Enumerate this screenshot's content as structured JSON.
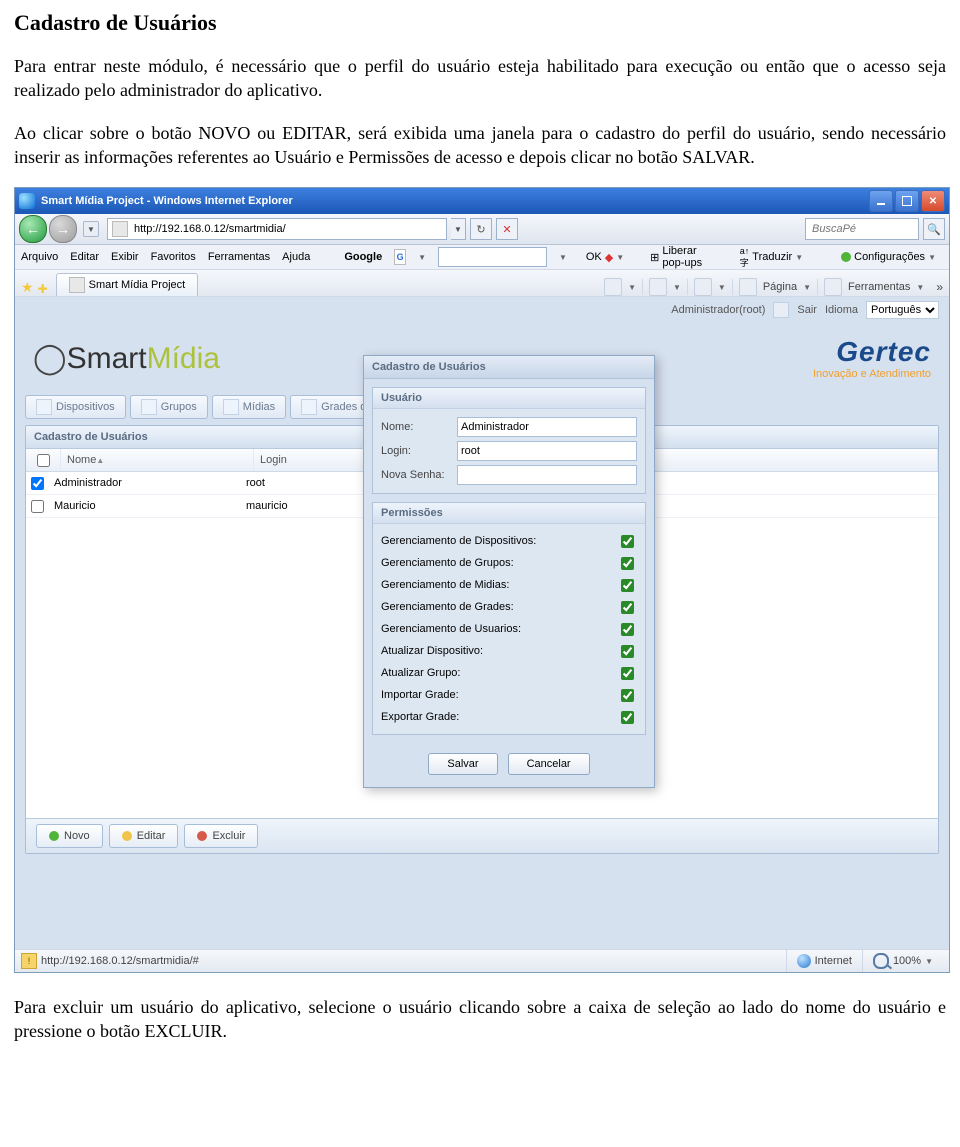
{
  "doc": {
    "heading": "Cadastro de Usuários",
    "p1": "Para entrar neste módulo, é necessário que o perfil do usuário esteja habilitado para execução ou então que o acesso seja realizado pelo administrador do aplicativo.",
    "p2": "Ao clicar sobre o botão NOVO ou EDITAR, será exibida uma janela para o cadastro do perfil do usuário, sendo necessário inserir as informações referentes ao Usuário e Permissões de acesso e depois clicar no botão SALVAR.",
    "p3": "Para excluir um usuário do aplicativo, selecione o usuário clicando sobre a caixa de seleção ao lado do nome do usuário e pressione o botão EXCLUIR."
  },
  "window": {
    "title": "Smart Mídia Project - Windows Internet Explorer"
  },
  "nav": {
    "url": "http://192.168.0.12/smartmidia/",
    "search_placeholder": "BuscaPé"
  },
  "menu": {
    "items": [
      "Arquivo",
      "Editar",
      "Exibir",
      "Favoritos",
      "Ferramentas",
      "Ajuda"
    ],
    "google_label": "Google",
    "g_btn": "G",
    "ok_label": "OK",
    "popup_label": "Liberar pop-ups",
    "translate_label": "Traduzir",
    "config_label": "Configurações"
  },
  "tab": {
    "title": "Smart Mídia Project",
    "pagina": "Página",
    "ferr": "Ferramentas"
  },
  "apptop": {
    "admin": "Administrador(root)",
    "sair": "Sair",
    "idioma_lbl": "Idioma",
    "idioma_val": "Português"
  },
  "logo": {
    "smart_a": "Smart",
    "smart_b": "Mídia",
    "gertec": "Gertec",
    "gertec_sub": "Inovação e Atendimento"
  },
  "navtabs": [
    "Dispositivos",
    "Grupos",
    "Mídias",
    "Grades de Program"
  ],
  "panel": {
    "title": "Cadastro de Usuários",
    "cols": [
      "Nome",
      "Login"
    ],
    "rows": [
      {
        "checked": true,
        "nome": "Administrador",
        "login": "root"
      },
      {
        "checked": false,
        "nome": "Mauricio",
        "login": "mauricio"
      }
    ],
    "novo": "Novo",
    "editar": "Editar",
    "excluir": "Excluir"
  },
  "modal": {
    "title": "Cadastro de Usuários",
    "user_section": "Usuário",
    "nome_lbl": "Nome:",
    "nome_val": "Administrador",
    "login_lbl": "Login:",
    "login_val": "root",
    "senha_lbl": "Nova Senha:",
    "senha_val": "",
    "perm_section": "Permissões",
    "perms": [
      "Gerenciamento de Dispositivos:",
      "Gerenciamento de Grupos:",
      "Gerenciamento de Midias:",
      "Gerenciamento de Grades:",
      "Gerenciamento de Usuarios:",
      "Atualizar Dispositivo:",
      "Atualizar Grupo:",
      "Importar Grade:",
      "Exportar Grade:"
    ],
    "salvar": "Salvar",
    "cancelar": "Cancelar"
  },
  "status": {
    "url": "http://192.168.0.12/smartmidia/#",
    "zone": "Internet",
    "zoom": "100%"
  }
}
